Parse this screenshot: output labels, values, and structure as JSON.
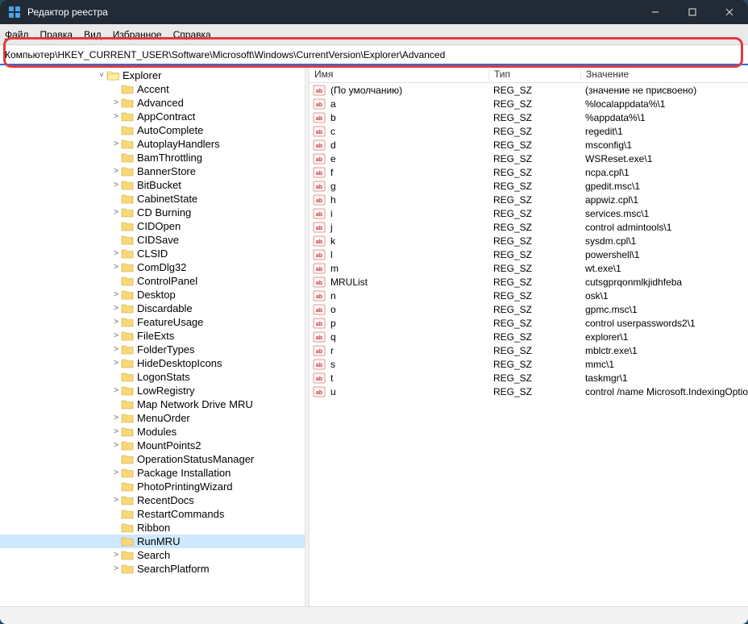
{
  "window": {
    "title": "Редактор реестра"
  },
  "menu": {
    "file": "Файл",
    "edit": "Правка",
    "view": "Вид",
    "favorites": "Избранное",
    "help": "Справка"
  },
  "address": {
    "value": "Компьютер\\HKEY_CURRENT_USER\\Software\\Microsoft\\Windows\\CurrentVersion\\Explorer\\Advanced"
  },
  "tree": {
    "explorer": "Explorer",
    "items": [
      {
        "label": "Accent",
        "exp": false
      },
      {
        "label": "Advanced",
        "exp": true
      },
      {
        "label": "AppContract",
        "exp": true
      },
      {
        "label": "AutoComplete",
        "exp": false
      },
      {
        "label": "AutoplayHandlers",
        "exp": true
      },
      {
        "label": "BamThrottling",
        "exp": false
      },
      {
        "label": "BannerStore",
        "exp": true
      },
      {
        "label": "BitBucket",
        "exp": true
      },
      {
        "label": "CabinetState",
        "exp": false
      },
      {
        "label": "CD Burning",
        "exp": true
      },
      {
        "label": "CIDOpen",
        "exp": false
      },
      {
        "label": "CIDSave",
        "exp": false
      },
      {
        "label": "CLSID",
        "exp": true
      },
      {
        "label": "ComDlg32",
        "exp": true
      },
      {
        "label": "ControlPanel",
        "exp": false
      },
      {
        "label": "Desktop",
        "exp": true
      },
      {
        "label": "Discardable",
        "exp": true
      },
      {
        "label": "FeatureUsage",
        "exp": true
      },
      {
        "label": "FileExts",
        "exp": true
      },
      {
        "label": "FolderTypes",
        "exp": true
      },
      {
        "label": "HideDesktopIcons",
        "exp": true
      },
      {
        "label": "LogonStats",
        "exp": false
      },
      {
        "label": "LowRegistry",
        "exp": true
      },
      {
        "label": "Map Network Drive MRU",
        "exp": false
      },
      {
        "label": "MenuOrder",
        "exp": true
      },
      {
        "label": "Modules",
        "exp": true
      },
      {
        "label": "MountPoints2",
        "exp": true
      },
      {
        "label": "OperationStatusManager",
        "exp": false
      },
      {
        "label": "Package Installation",
        "exp": true
      },
      {
        "label": "PhotoPrintingWizard",
        "exp": false
      },
      {
        "label": "RecentDocs",
        "exp": true
      },
      {
        "label": "RestartCommands",
        "exp": false
      },
      {
        "label": "Ribbon",
        "exp": false
      },
      {
        "label": "RunMRU",
        "exp": false,
        "selected": true
      },
      {
        "label": "Search",
        "exp": true
      },
      {
        "label": "SearchPlatform",
        "exp": true
      }
    ]
  },
  "columns": {
    "name": "Имя",
    "type": "Тип",
    "value": "Значение"
  },
  "values": [
    {
      "name": "(По умолчанию)",
      "type": "REG_SZ",
      "data": "(значение не присвоено)"
    },
    {
      "name": "a",
      "type": "REG_SZ",
      "data": "%localappdata%\\1"
    },
    {
      "name": "b",
      "type": "REG_SZ",
      "data": "%appdata%\\1"
    },
    {
      "name": "c",
      "type": "REG_SZ",
      "data": "regedit\\1"
    },
    {
      "name": "d",
      "type": "REG_SZ",
      "data": "msconfig\\1"
    },
    {
      "name": "e",
      "type": "REG_SZ",
      "data": "WSReset.exe\\1"
    },
    {
      "name": "f",
      "type": "REG_SZ",
      "data": "ncpa.cpl\\1"
    },
    {
      "name": "g",
      "type": "REG_SZ",
      "data": "gpedit.msc\\1"
    },
    {
      "name": "h",
      "type": "REG_SZ",
      "data": "appwiz.cpl\\1"
    },
    {
      "name": "i",
      "type": "REG_SZ",
      "data": "services.msc\\1"
    },
    {
      "name": "j",
      "type": "REG_SZ",
      "data": "control admintools\\1"
    },
    {
      "name": "k",
      "type": "REG_SZ",
      "data": "sysdm.cpl\\1"
    },
    {
      "name": "l",
      "type": "REG_SZ",
      "data": "powershell\\1"
    },
    {
      "name": "m",
      "type": "REG_SZ",
      "data": "wt.exe\\1"
    },
    {
      "name": "MRUList",
      "type": "REG_SZ",
      "data": "cutsgprqonmlkjidhfeba"
    },
    {
      "name": "n",
      "type": "REG_SZ",
      "data": "osk\\1"
    },
    {
      "name": "o",
      "type": "REG_SZ",
      "data": "gpmc.msc\\1"
    },
    {
      "name": "p",
      "type": "REG_SZ",
      "data": "control userpasswords2\\1"
    },
    {
      "name": "q",
      "type": "REG_SZ",
      "data": "explorer\\1"
    },
    {
      "name": "r",
      "type": "REG_SZ",
      "data": "mblctr.exe\\1"
    },
    {
      "name": "s",
      "type": "REG_SZ",
      "data": "mmc\\1"
    },
    {
      "name": "t",
      "type": "REG_SZ",
      "data": "taskmgr\\1"
    },
    {
      "name": "u",
      "type": "REG_SZ",
      "data": "control /name Microsoft.IndexingOptions"
    }
  ]
}
